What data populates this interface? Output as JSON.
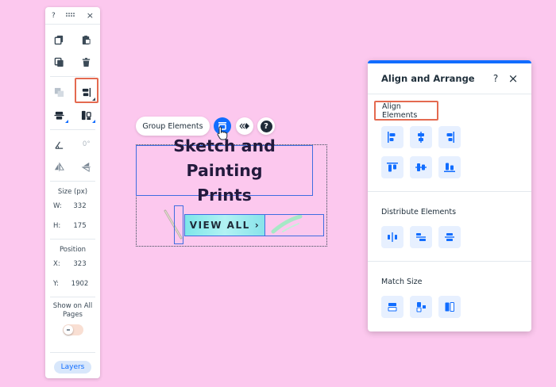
{
  "toolbar": {
    "help_label": "?",
    "close_label": "×",
    "rotation_value": "0°",
    "size_label": "Size (px)",
    "width_key": "W:",
    "width_value": "332",
    "height_key": "H:",
    "height_value": "175",
    "position_label": "Position",
    "x_key": "X:",
    "x_value": "323",
    "y_key": "Y:",
    "y_value": "1902",
    "show_all_pages_label": "Show on All Pages",
    "layers_label": "Layers"
  },
  "canvas": {
    "group_elements_label": "Group Elements",
    "heading_line1": "Sketch and Painting",
    "heading_line2": "Prints",
    "button_label": "VIEW ALL",
    "help_label": "?"
  },
  "panel": {
    "title": "Align and Arrange",
    "help_label": "?",
    "close_label": "×",
    "align_label": "Align Elements",
    "distribute_label": "Distribute Elements",
    "match_label": "Match Size"
  },
  "colors": {
    "background": "#fcc8ee",
    "accent": "#116dff",
    "highlight": "#e46a50",
    "selection": "#3f6de0"
  }
}
